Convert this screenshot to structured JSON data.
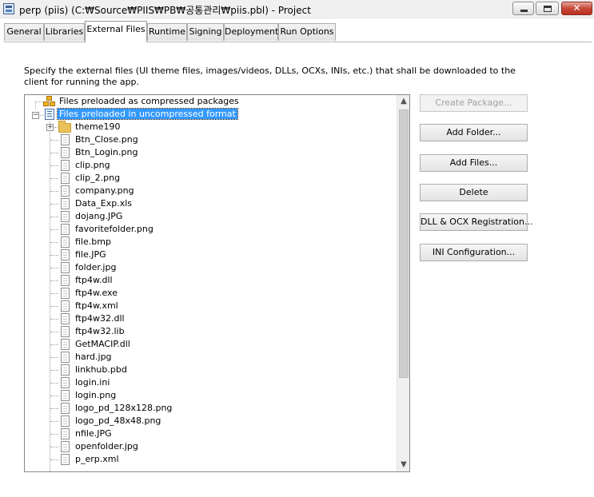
{
  "window": {
    "title": "perp (piis) (C:₩Source₩PIIS₩PB₩공통관리₩piis.pbl) - Project",
    "close_glyph": "✕"
  },
  "tabs": [
    {
      "label": "General"
    },
    {
      "label": "Libraries"
    },
    {
      "label": "External Files"
    },
    {
      "label": "Runtime"
    },
    {
      "label": "Signing"
    },
    {
      "label": "Deployment"
    },
    {
      "label": "Run Options"
    }
  ],
  "active_tab": "External Files",
  "description": "Specify the external files (UI theme files, images/videos, DLLs, OCXs, INIs, etc.) that shall be downloaded to the client for running the app.",
  "tree": {
    "compressed_label": "Files preloaded as compressed packages",
    "uncompressed_label": "Files preloaded in uncompressed format",
    "folder_label": "theme190",
    "expand_glyph": "+",
    "collapse_glyph": "−",
    "files": [
      "Btn_Close.png",
      "Btn_Login.png",
      "clip.png",
      "clip_2.png",
      "company.png",
      "Data_Exp.xls",
      "dojang.JPG",
      "favoritefolder.png",
      "file.bmp",
      "file.JPG",
      "folder.jpg",
      "ftp4w.dll",
      "ftp4w.exe",
      "ftp4w.xml",
      "ftp4w32.dll",
      "ftp4w32.lib",
      "GetMACIP.dll",
      "hard.jpg",
      "linkhub.pbd",
      "login.ini",
      "login.png",
      "logo_pd_128x128.png",
      "logo_pd_48x48.png",
      "nfile.JPG",
      "openfolder.jpg",
      "p_erp.xml"
    ]
  },
  "scrollbar": {
    "up": "▲",
    "down": "▼"
  },
  "buttons": {
    "create_package": "Create Package...",
    "add_folder": "Add Folder...",
    "add_files": "Add Files...",
    "delete": "Delete",
    "dll_ocx": "DLL & OCX Registration...",
    "ini_config": "INI Configuration..."
  },
  "colors": {
    "selection": "#3399ff",
    "window_bg": "#f0f0f0"
  }
}
